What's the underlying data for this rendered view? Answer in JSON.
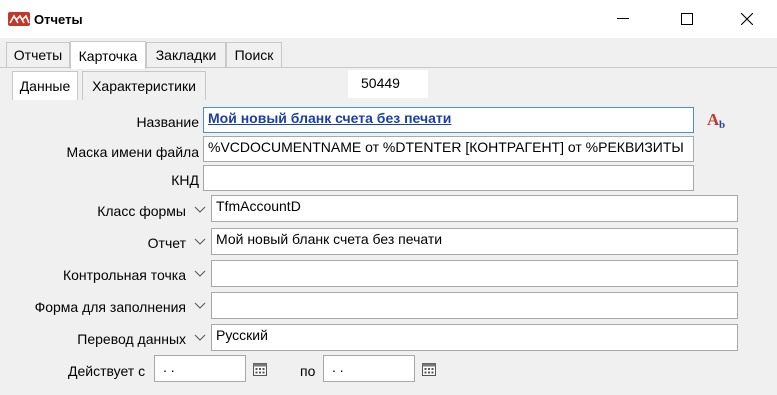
{
  "window": {
    "title": "Отчеты"
  },
  "tabs": [
    "Отчеты",
    "Карточка",
    "Закладки",
    "Поиск"
  ],
  "subtabs": [
    "Данные",
    "Характеристики"
  ],
  "record_id": "50449",
  "fields": {
    "name": {
      "label": "Название",
      "value": "Мой новый бланк счета без печати"
    },
    "file_mask": {
      "label": "Маска имени файла",
      "value": "%VCDOCUMENTNAME от %DTENTER [КОНТРАГЕНТ] от %РЕКВИЗИТЫ"
    },
    "knd": {
      "label": "КНД",
      "value": ""
    },
    "form_class": {
      "label": "Класс формы",
      "value": "TfmAccountD"
    },
    "report": {
      "label": "Отчет",
      "value": "Мой новый бланк счета без печати"
    },
    "checkpoint": {
      "label": "Контрольная точка",
      "value": ""
    },
    "fill_form": {
      "label": "Форма для заполнения",
      "value": ""
    },
    "translation": {
      "label": "Перевод данных",
      "value": "Русский"
    }
  },
  "validity": {
    "from_label": "Действует с",
    "from_value": " .  . ",
    "to_label": "по",
    "to_value": " .  . "
  },
  "icons": {
    "font_icon": "font-style-icon",
    "calendar": "calendar-icon"
  }
}
